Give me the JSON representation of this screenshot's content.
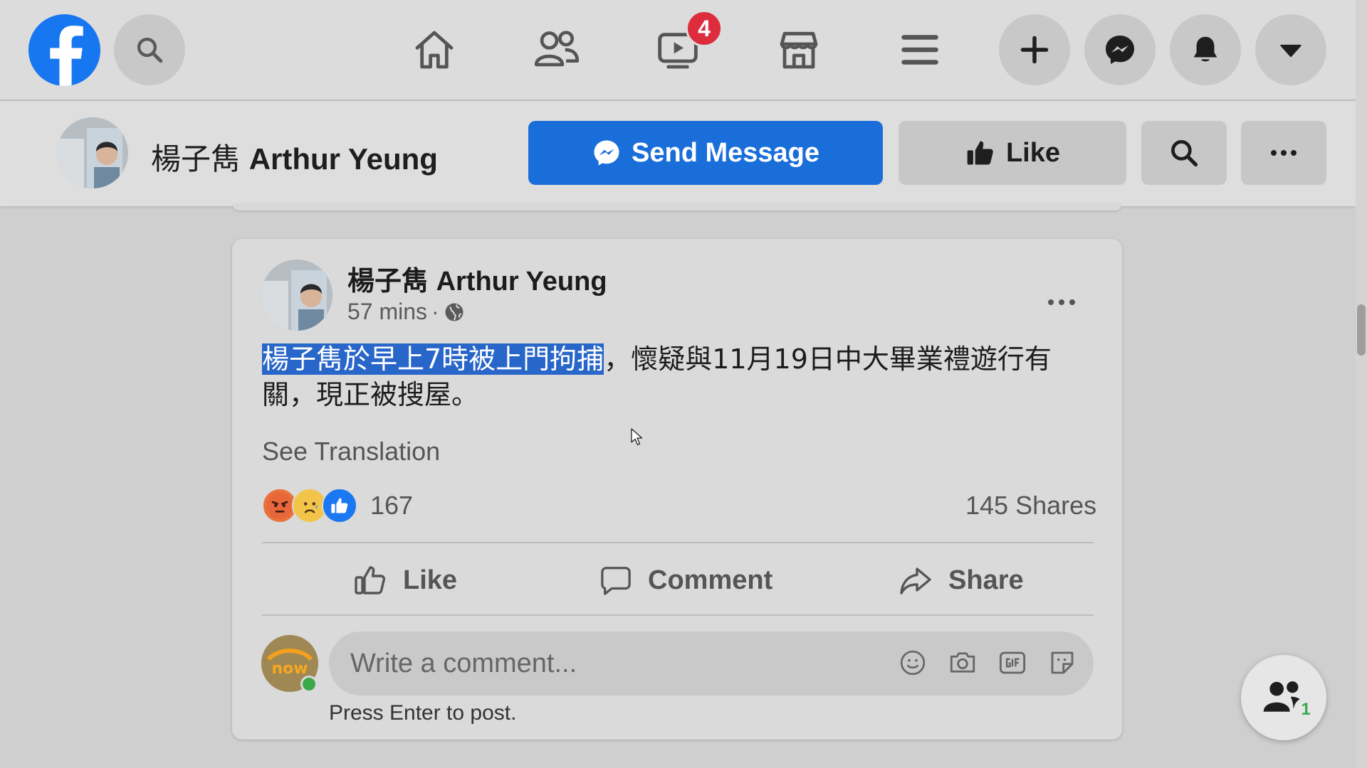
{
  "nav": {
    "watch_badge": "4"
  },
  "page_header": {
    "name_cjk": "楊子雋",
    "name_en": "Arthur Yeung",
    "send_message_label": "Send Message",
    "like_label": "Like"
  },
  "post": {
    "author_cjk": "楊子雋",
    "author_en": "Arthur Yeung",
    "time": "57 mins",
    "meta_sep": "·",
    "text_highlighted": "楊子雋於早上7時被上門拘捕",
    "text_rest": "，懷疑與11月19日中大畢業禮遊行有關，現正被搜屋。",
    "see_translation": "See Translation",
    "reaction_count": "167",
    "shares": "145 Shares",
    "actions": {
      "like": "Like",
      "comment": "Comment",
      "share": "Share"
    },
    "comment_placeholder": "Write a comment...",
    "press_enter": "Press Enter to post."
  },
  "contacts_badge": "1",
  "colors": {
    "brand": "#1777f0",
    "send_button": "#1a6ed9",
    "badge": "#dd2c3c",
    "highlight": "#2866c9"
  }
}
